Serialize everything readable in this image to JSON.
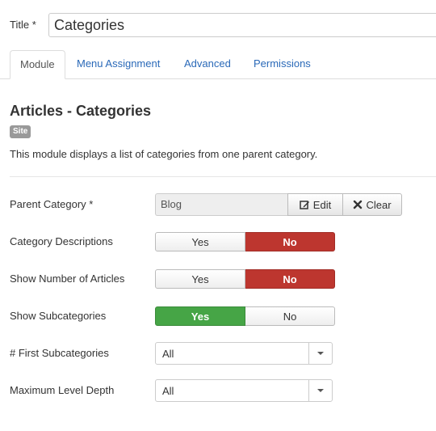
{
  "title_field": {
    "label": "Title *",
    "value": "Categories"
  },
  "tabs": [
    {
      "label": "Module",
      "active": true
    },
    {
      "label": "Menu Assignment",
      "active": false
    },
    {
      "label": "Advanced",
      "active": false
    },
    {
      "label": "Permissions",
      "active": false
    }
  ],
  "module": {
    "heading": "Articles - Categories",
    "badge": "Site",
    "description": "This module displays a list of categories from one parent category."
  },
  "fields": {
    "parent_category": {
      "label": "Parent Category *",
      "value": "Blog",
      "edit_label": "Edit",
      "clear_label": "Clear"
    },
    "category_descriptions": {
      "label": "Category Descriptions",
      "yes": "Yes",
      "no": "No",
      "selected": "No"
    },
    "show_number_of_articles": {
      "label": "Show Number of Articles",
      "yes": "Yes",
      "no": "No",
      "selected": "No"
    },
    "show_subcategories": {
      "label": "Show Subcategories",
      "yes": "Yes",
      "no": "No",
      "selected": "Yes"
    },
    "first_subcategories": {
      "label": "# First Subcategories",
      "value": "All"
    },
    "maximum_level_depth": {
      "label": "Maximum Level Depth",
      "value": "All"
    }
  },
  "colors": {
    "accent_link": "#2a69b8",
    "no_selected": "#bd362f",
    "yes_selected": "#46a546",
    "badge": "#999999"
  },
  "icons": {
    "edit": "edit-square-icon",
    "clear": "x-icon",
    "dropdown": "caret-down-icon"
  }
}
